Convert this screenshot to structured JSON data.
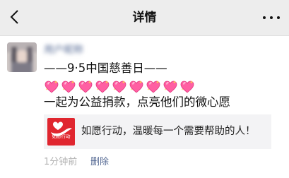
{
  "nav": {
    "title": "详情",
    "back_icon": "chevron-left-icon",
    "more_icon": "more-dots-icon"
  },
  "post": {
    "username": "用户昵称",
    "line1": "——9·5中国慈善日——",
    "heart_count": 9,
    "heart_icon": "sparkling-heart-emoji",
    "line3": "一起为公益捐款，点亮他们的微心愿",
    "share": {
      "logo_text": "如愿行动",
      "logo_color": "#e0262f",
      "title": "如愿行动，温暖每一个需要帮助的人！"
    },
    "time": "1分钟前",
    "delete_label": "删除"
  },
  "colors": {
    "nav_bg": "#ededed",
    "link": "#576b95",
    "meta": "#b2b2b2",
    "card_bg": "#f3f3f5",
    "heart": "#ff5fa2"
  }
}
